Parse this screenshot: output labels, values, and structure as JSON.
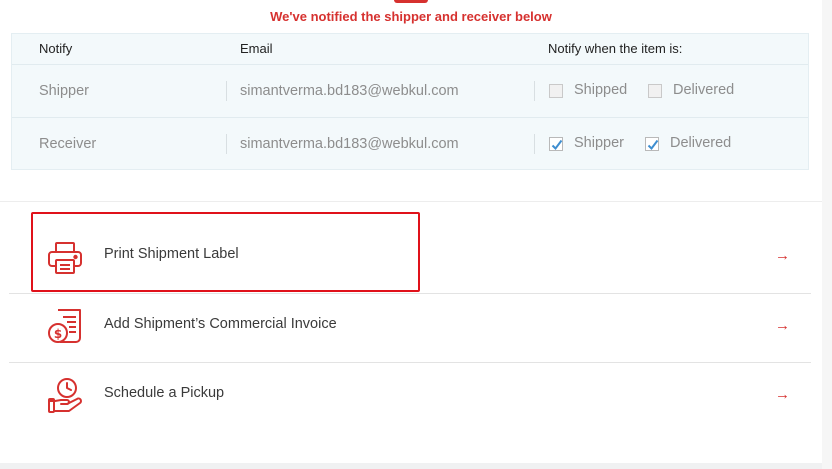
{
  "notice": "We've notified the shipper and receiver below",
  "table": {
    "headers": {
      "notify": "Notify",
      "email": "Email",
      "when": "Notify when the item is:"
    },
    "rows": [
      {
        "role": "Shipper",
        "email": "simantverma.bd183@webkul.com",
        "opt1": {
          "label": "Shipped",
          "checked": false
        },
        "opt2": {
          "label": "Delivered",
          "checked": false
        }
      },
      {
        "role": "Receiver",
        "email": "simantverma.bd183@webkul.com",
        "opt1": {
          "label": "Shipper",
          "checked": true
        },
        "opt2": {
          "label": "Delivered",
          "checked": true
        }
      }
    ]
  },
  "actions": [
    {
      "label": "Print Shipment Label",
      "icon": "printer-icon"
    },
    {
      "label": "Add Shipment’s Commercial Invoice",
      "icon": "invoice-icon"
    },
    {
      "label": "Schedule a Pickup",
      "icon": "pickup-clock-hand-icon"
    }
  ],
  "arrow_glyph": "→",
  "colors": {
    "accent": "#d6312f",
    "highlight": "#e0111a",
    "table_bg": "#f3f9fb"
  }
}
